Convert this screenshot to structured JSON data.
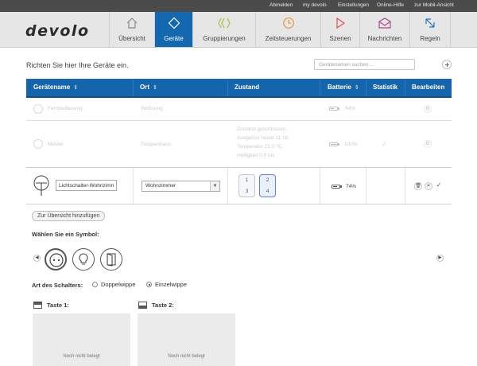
{
  "topbar": {
    "links": [
      "Abmelden",
      "my devolo",
      "Einstellungen",
      "Online-Hilfe",
      "zur Mobil-Ansicht"
    ]
  },
  "brand": {
    "logo": "devolo"
  },
  "nav": {
    "tabs": [
      {
        "label": "Übersicht",
        "icon": "home-icon",
        "active": false
      },
      {
        "label": "Geräte",
        "icon": "diamond-icon",
        "active": true
      },
      {
        "label": "Gruppierungen",
        "icon": "groups-icon",
        "active": false
      },
      {
        "label": "Zeitsteuerungen",
        "icon": "clock-icon",
        "active": false
      },
      {
        "label": "Szenen",
        "icon": "play-icon",
        "active": false
      },
      {
        "label": "Nachrichten",
        "icon": "mail-icon",
        "active": false
      },
      {
        "label": "Regeln",
        "icon": "rules-icon",
        "active": false
      }
    ],
    "active_color": "#1368b0"
  },
  "intro": "Richten Sie hier Ihre Geräte ein.",
  "search": {
    "placeholder": "Gerätenamen suchen..."
  },
  "table": {
    "headers": {
      "name": "Gerätename",
      "location": "Ort",
      "state": "Zustand",
      "battery": "Batterie",
      "stats": "Statistik",
      "edit": "Bearbeiten"
    },
    "header_color": "#1565ad",
    "rows": [
      {
        "name": "Fernbedienung",
        "location": "Wohnung",
        "state": [],
        "battery": "64%",
        "battery_level": 0.64
      },
      {
        "name": "Melder",
        "location": "Treppenhaus",
        "state": [
          "Zustand geschlossen,",
          "Ausgelöst heute 11:16,",
          "Temperatur 21.0 °C,",
          "Helligkeit 0.0 lux"
        ],
        "battery": "100%",
        "battery_level": 1.0
      }
    ],
    "edit_row": {
      "name_value": "Lichtschalter-Wohnzimmer",
      "location_value": "Wohnzimmer",
      "rocker_left": [
        "1",
        "3"
      ],
      "rocker_right": [
        "2",
        "4"
      ],
      "battery": "74%",
      "battery_level": 0.74
    }
  },
  "form": {
    "add_to_overview": "Zur Übersicht hinzufügen",
    "choose_symbol": "Wählen Sie ein Symbol:",
    "symbols": [
      "socket-icon",
      "bulb-icon",
      "door-icon"
    ],
    "switch_type_label": "Art des Schalters:",
    "switch_options": [
      {
        "label": "Doppelwippe",
        "selected": false
      },
      {
        "label": "Einzelwippe",
        "selected": true
      }
    ],
    "keys": [
      {
        "label": "Taste 1:",
        "status": "Noch nicht belegt"
      },
      {
        "label": "Taste 2:",
        "status": "Noch nicht belegt"
      }
    ]
  }
}
